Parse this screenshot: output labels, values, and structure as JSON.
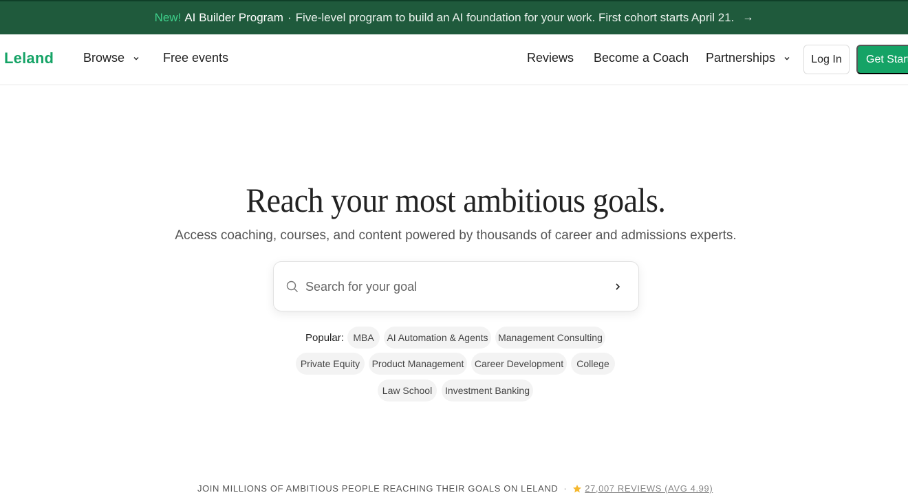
{
  "announcement": {
    "new_label": "New!",
    "program_label": "AI Builder Program",
    "separator": "·",
    "message": "Five-level program to build an AI foundation for your work. First cohort starts April 21.",
    "arrow": "→"
  },
  "nav": {
    "logo": "Leland",
    "browse": "Browse",
    "free_events": "Free events",
    "reviews": "Reviews",
    "become_coach": "Become a Coach",
    "partnerships": "Partnerships",
    "login": "Log In",
    "get_started": "Get Started"
  },
  "hero": {
    "title": "Reach your most ambitious goals.",
    "subtitle": "Access coaching, courses, and content powered by thousands of career and admissions experts."
  },
  "search": {
    "placeholder": "Search for your goal"
  },
  "popular": {
    "label": "Popular:",
    "chips": [
      "MBA",
      "AI Automation & Agents",
      "Management Consulting",
      "Private Equity",
      "Product Management",
      "Career Development",
      "College",
      "Law School",
      "Investment Banking"
    ]
  },
  "footer": {
    "tagline": "JOIN MILLIONS OF AMBITIOUS PEOPLE REACHING THEIR GOALS ON LELAND",
    "separator": "·",
    "reviews_link": "27,007 REVIEWS (AVG 4.99)"
  },
  "colors": {
    "brand_green": "#15a366",
    "banner_bg": "#1f5a3c",
    "new_accent": "#3fd08b",
    "star": "#f5b82e"
  }
}
